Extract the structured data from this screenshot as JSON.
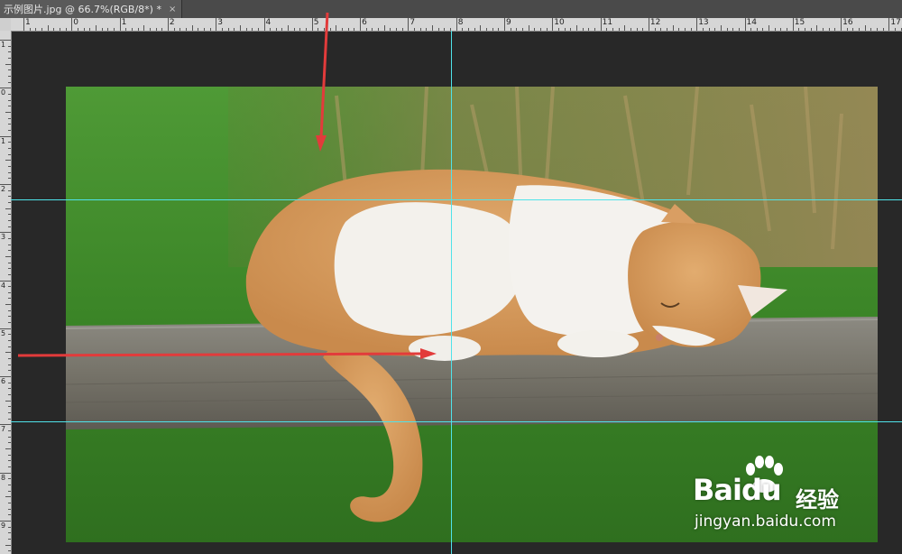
{
  "document": {
    "tab_title": "示例图片.jpg @ 66.7%(RGB/8*) *",
    "close_glyph": "×"
  },
  "rulers": {
    "top_labels": [
      "1",
      "0",
      "1",
      "2",
      "3",
      "4",
      "5",
      "6",
      "7",
      "8",
      "9",
      "10",
      "11",
      "12",
      "13",
      "14",
      "15",
      "16",
      "17"
    ],
    "left_labels": [
      "1",
      "0",
      "1",
      "2",
      "3",
      "4",
      "5",
      "6",
      "7",
      "8",
      "9"
    ]
  },
  "canvas": {
    "subject": "sleeping orange-and-white cat on a wooden fence rail over grass",
    "colors": {
      "grass": "#3e8a2a",
      "reeds": "#9c8a5c",
      "wood": "#7d7b74",
      "fur_orange": "#d9a062",
      "fur_white": "#f2f0ec",
      "guide": "#4fe3ea",
      "arrow": "#e23b3b"
    }
  },
  "watermark": {
    "logo": "Bai",
    "logo_du": "du",
    "service": "经验",
    "url": "jingyan.baidu.com"
  },
  "icons": {
    "arrow_down": "red-arrow-down-icon",
    "arrow_right": "red-arrow-right-icon",
    "paw": "baidu-paw-icon"
  }
}
